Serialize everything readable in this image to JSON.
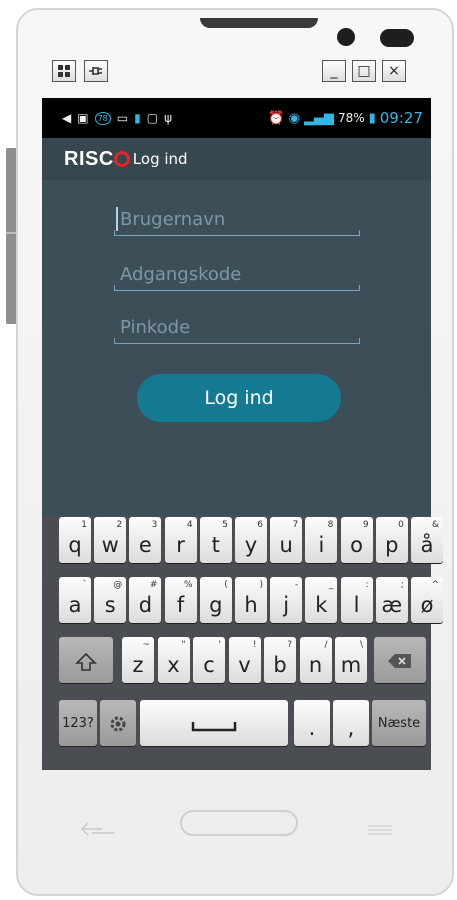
{
  "window_controls": {
    "minimize": "_",
    "maximize": "□",
    "close": "×"
  },
  "top_left_icons": [
    "grid-icon",
    "plug-icon"
  ],
  "status_bar": {
    "battery": "78%",
    "time": "09:27",
    "notification_count": "78"
  },
  "app": {
    "brand": "RISC",
    "title": "Log ind"
  },
  "form": {
    "username_placeholder": "Brugernavn",
    "password_placeholder": "Adgangskode",
    "pin_placeholder": "Pinkode",
    "login_label": "Log ind"
  },
  "keyboard": {
    "row1": [
      {
        "k": "q",
        "s": "1"
      },
      {
        "k": "w",
        "s": "2"
      },
      {
        "k": "e",
        "s": "3"
      },
      {
        "k": "r",
        "s": "4"
      },
      {
        "k": "t",
        "s": "5"
      },
      {
        "k": "y",
        "s": "6"
      },
      {
        "k": "u",
        "s": "7"
      },
      {
        "k": "i",
        "s": "8"
      },
      {
        "k": "o",
        "s": "9"
      },
      {
        "k": "p",
        "s": "0"
      },
      {
        "k": "å",
        "s": "&"
      }
    ],
    "row2": [
      {
        "k": "a",
        "s": "`"
      },
      {
        "k": "s",
        "s": "@"
      },
      {
        "k": "d",
        "s": "#"
      },
      {
        "k": "f",
        "s": "%"
      },
      {
        "k": "g",
        "s": "("
      },
      {
        "k": "h",
        "s": ")"
      },
      {
        "k": "j",
        "s": "-"
      },
      {
        "k": "k",
        "s": "_"
      },
      {
        "k": "l",
        "s": ":"
      },
      {
        "k": "æ",
        "s": ";"
      },
      {
        "k": "ø",
        "s": "^"
      }
    ],
    "row3": [
      {
        "k": "z",
        "s": "~"
      },
      {
        "k": "x",
        "s": "\""
      },
      {
        "k": "c",
        "s": "'"
      },
      {
        "k": "v",
        "s": "!"
      },
      {
        "k": "b",
        "s": "?"
      },
      {
        "k": "n",
        "s": "/"
      },
      {
        "k": "m",
        "s": "\\"
      }
    ],
    "numbers_label": "123?",
    "period": ".",
    "comma": ",",
    "next_label": "Næste"
  }
}
